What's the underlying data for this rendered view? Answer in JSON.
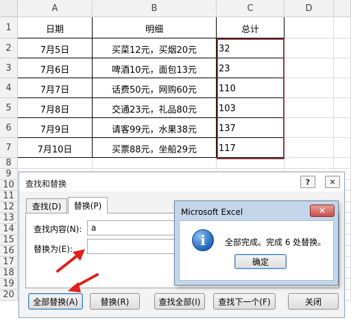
{
  "spreadsheet": {
    "columns": [
      "A",
      "B",
      "C",
      "D"
    ],
    "rows": [
      "1",
      "2",
      "3",
      "4",
      "5",
      "6",
      "7",
      "8",
      "9",
      "10",
      "11",
      "12",
      "13",
      "14",
      "15",
      "16",
      "17",
      "18",
      "19",
      "20"
    ],
    "header": [
      "日期",
      "明细",
      "总计"
    ],
    "data": [
      [
        "7月5日",
        "买菜12元，买烟20元",
        "32"
      ],
      [
        "7月6日",
        "啤酒10元，面包13元",
        "23"
      ],
      [
        "7月7日",
        "话费50元，网购60元",
        "110"
      ],
      [
        "7月8日",
        "交通23元，礼品80元",
        "103"
      ],
      [
        "7月9日",
        "请客99元，水果38元",
        "137"
      ],
      [
        "7月10日",
        "买票88元，坐船29元",
        "117"
      ]
    ]
  },
  "find_replace_dialog": {
    "title": "查找和替换",
    "help_button": "?",
    "close_button": "✕",
    "tabs": [
      "查找(D)",
      "替换(P)"
    ],
    "find_label": "查找内容(N):",
    "find_value": "a",
    "replace_label": "替换为(E):",
    "replace_value": "",
    "buttons": {
      "replace_all": "全部替换(A)",
      "replace": "替换(R)",
      "find_all": "查找全部(I)",
      "find_next": "查找下一个(F)",
      "close": "关闭"
    }
  },
  "message_box": {
    "title": "Microsoft Excel",
    "close_button": "✕",
    "icon": "info-icon",
    "message": "全部完成。完成 6 处替换。",
    "ok_button": "确定"
  },
  "colors": {
    "selection_border": "#8b3a3a",
    "annotation_arrow": "#e0201a"
  }
}
